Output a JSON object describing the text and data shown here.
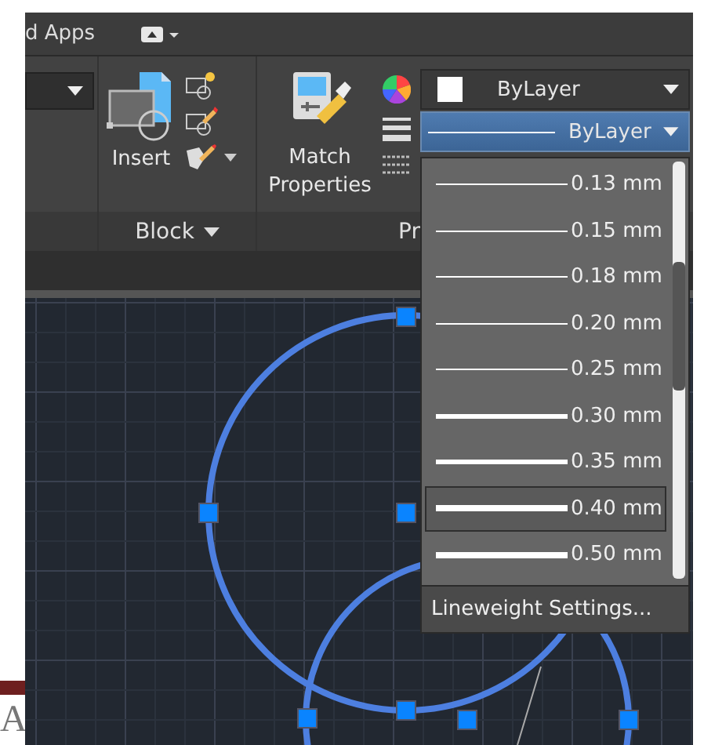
{
  "tabs": [
    {
      "label": "d Apps",
      "selected": false
    }
  ],
  "ribbon": {
    "block_panel": {
      "title": "Block",
      "insert_button": "Insert"
    },
    "properties_panel": {
      "title": "Pr",
      "match_button": "Match Properties"
    }
  },
  "color_combo": {
    "value": "ByLayer"
  },
  "lineweight_combo": {
    "value": "ByLayer",
    "expanded": true,
    "options": [
      {
        "label": "0.13 mm",
        "kind": "thin",
        "selected": false
      },
      {
        "label": "0.15 mm",
        "kind": "thin",
        "selected": false
      },
      {
        "label": "0.18 mm",
        "kind": "thin",
        "selected": false
      },
      {
        "label": "0.20 mm",
        "kind": "thin",
        "selected": false
      },
      {
        "label": "0.25 mm",
        "kind": "thin",
        "selected": false
      },
      {
        "label": "0.30 mm",
        "kind": "medium",
        "selected": false
      },
      {
        "label": "0.35 mm",
        "kind": "medium",
        "selected": false
      },
      {
        "label": "0.40 mm",
        "kind": "thick",
        "selected": true
      },
      {
        "label": "0.50 mm",
        "kind": "thick",
        "selected": false
      }
    ],
    "settings_link": "Lineweight Settings..."
  },
  "background_page": {
    "letter": "A"
  }
}
